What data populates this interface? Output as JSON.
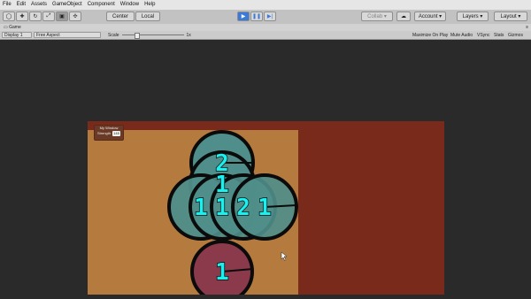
{
  "menu": [
    "File",
    "Edit",
    "Assets",
    "GameObject",
    "Component",
    "Window",
    "Help"
  ],
  "toolbar": {
    "pivot_label": "Center",
    "space_label": "Local",
    "collab_label": "Collab ▾",
    "account_label": "Account",
    "layers_label": "Layers",
    "layout_label": "Layout"
  },
  "game_tab": {
    "label": "Game"
  },
  "game_toolbar": {
    "display": "Display 1",
    "aspect": "Free Aspect",
    "scale_label": "Scale",
    "scale_value": "1x",
    "maximize": "Maximize On Play",
    "mute": "Mute Audio",
    "vsync": "VSync",
    "stats": "Stats",
    "gizmos": "Gizmos"
  },
  "game_window": {
    "title": "My Window",
    "strength_label": "Strength",
    "strength_value": "145"
  },
  "circles": [
    {
      "label": "2"
    },
    {
      "label": "1"
    },
    {
      "label": "1"
    },
    {
      "label": "1"
    },
    {
      "label": "2"
    },
    {
      "label": "1"
    },
    {
      "label": "1"
    }
  ],
  "colors": {
    "teal": "#4f8e8a",
    "crimson": "#8a3a4a",
    "digit": "#19f0f0",
    "panel": "#b57a3e",
    "background": "#7a2a1a"
  }
}
